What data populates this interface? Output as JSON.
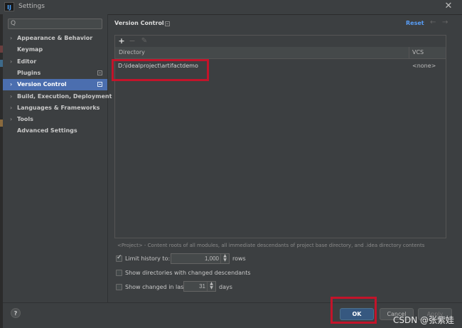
{
  "window": {
    "app_icon_text": "IJ",
    "title": "Settings",
    "close_glyph": "✕"
  },
  "sidebar": {
    "search": {
      "value": "",
      "placeholder": "",
      "icon": "search-icon"
    },
    "items": [
      {
        "label": "Appearance & Behavior",
        "expandable": true,
        "badge": false,
        "selected": false
      },
      {
        "label": "Keymap",
        "expandable": false,
        "badge": false,
        "selected": false
      },
      {
        "label": "Editor",
        "expandable": true,
        "badge": false,
        "selected": false
      },
      {
        "label": "Plugins",
        "expandable": false,
        "badge": true,
        "selected": false
      },
      {
        "label": "Version Control",
        "expandable": true,
        "badge": true,
        "selected": true
      },
      {
        "label": "Build, Execution, Deployment",
        "expandable": true,
        "badge": false,
        "selected": false
      },
      {
        "label": "Languages & Frameworks",
        "expandable": true,
        "badge": false,
        "selected": false
      },
      {
        "label": "Tools",
        "expandable": true,
        "badge": false,
        "selected": false
      },
      {
        "label": "Advanced Settings",
        "expandable": false,
        "badge": false,
        "selected": false
      }
    ]
  },
  "main": {
    "title": "Version Control",
    "reset_label": "Reset",
    "back_arrow": "←",
    "forward_arrow": "→",
    "toolbar": {
      "add": "+",
      "remove": "−",
      "edit": "✎"
    },
    "table": {
      "headers": {
        "directory": "Directory",
        "vcs": "VCS"
      },
      "rows": [
        {
          "directory": "D:\\idealproject\\artifactdemo",
          "vcs": "<none>"
        }
      ]
    },
    "hint": "<Project> - Content roots of all modules, all immediate descendants of project base directory, and .idea directory contents",
    "options": {
      "limit_history": {
        "label": "Limit history to:",
        "checked": true,
        "value": "1,000",
        "suffix": "rows"
      },
      "show_dirs": {
        "label": "Show directories with changed descendants",
        "checked": false
      },
      "show_changed": {
        "label": "Show changed in last",
        "checked": false,
        "value": "31",
        "suffix": "days"
      }
    }
  },
  "footer": {
    "help": "?",
    "ok": "OK",
    "cancel": "Cancel",
    "apply": "Apply"
  },
  "watermark": "CSDN @张紫娃",
  "colors": {
    "background": "#3c3f41",
    "selection": "#4b6eaf",
    "link": "#589df6",
    "ok_button": "#365880",
    "highlight_box": "#c3142a"
  }
}
